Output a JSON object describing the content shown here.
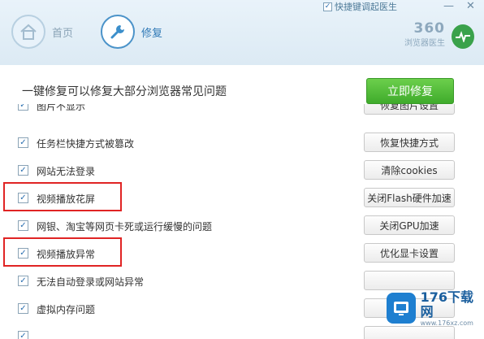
{
  "topbar": {
    "checkbox_label": "快捷键调起医生",
    "checkbox_checked": true
  },
  "nav": {
    "home_label": "首页",
    "repair_label": "修复"
  },
  "brand": {
    "name": "360",
    "subtitle": "浏览器医生"
  },
  "main": {
    "description": "一键修复可以修复大部分浏览器常见问题",
    "repair_button": "立即修复"
  },
  "items": [
    {
      "label": "图片不显示",
      "checked": true,
      "button": "恢复图片设置"
    },
    {
      "label": "任务栏快捷方式被篡改",
      "checked": true,
      "button": "恢复快捷方式"
    },
    {
      "label": "网站无法登录",
      "checked": true,
      "button": "清除cookies"
    },
    {
      "label": "视频播放花屏",
      "checked": true,
      "button": "关闭Flash硬件加速"
    },
    {
      "label": "网银、淘宝等网页卡死或运行缓慢的问题",
      "checked": true,
      "button": "关闭GPU加速"
    },
    {
      "label": "视频播放异常",
      "checked": true,
      "button": "优化显卡设置"
    },
    {
      "label": "无法自动登录或网站异常",
      "checked": true,
      "button": ""
    },
    {
      "label": "虚拟内存问题",
      "checked": true,
      "button": ""
    },
    {
      "label": "",
      "checked": true,
      "button": ""
    }
  ],
  "watermark": {
    "main": "176下载网",
    "sub": "www.176xz.com"
  },
  "colors": {
    "accent": "#2f79b6",
    "repair_green": "#3fab2b",
    "highlight_red": "#e02424"
  }
}
